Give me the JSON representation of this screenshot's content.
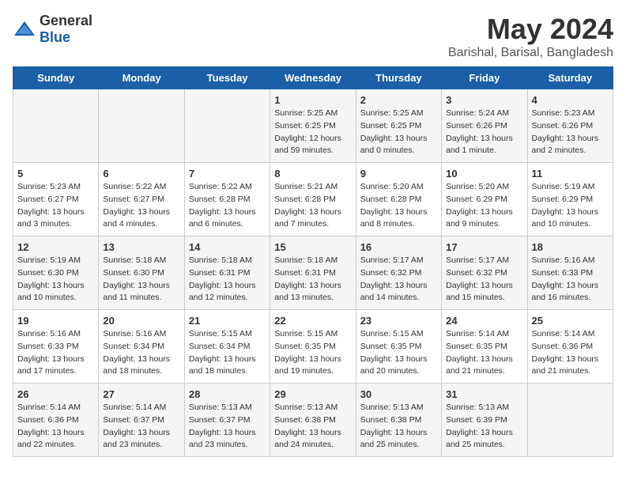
{
  "logo": {
    "general": "General",
    "blue": "Blue"
  },
  "title": "May 2024",
  "subtitle": "Barishal, Barisal, Bangladesh",
  "days_of_week": [
    "Sunday",
    "Monday",
    "Tuesday",
    "Wednesday",
    "Thursday",
    "Friday",
    "Saturday"
  ],
  "weeks": [
    [
      {
        "day": "",
        "info": ""
      },
      {
        "day": "",
        "info": ""
      },
      {
        "day": "",
        "info": ""
      },
      {
        "day": "1",
        "info": "Sunrise: 5:25 AM\nSunset: 6:25 PM\nDaylight: 12 hours\nand 59 minutes."
      },
      {
        "day": "2",
        "info": "Sunrise: 5:25 AM\nSunset: 6:25 PM\nDaylight: 13 hours\nand 0 minutes."
      },
      {
        "day": "3",
        "info": "Sunrise: 5:24 AM\nSunset: 6:26 PM\nDaylight: 13 hours\nand 1 minute."
      },
      {
        "day": "4",
        "info": "Sunrise: 5:23 AM\nSunset: 6:26 PM\nDaylight: 13 hours\nand 2 minutes."
      }
    ],
    [
      {
        "day": "5",
        "info": "Sunrise: 5:23 AM\nSunset: 6:27 PM\nDaylight: 13 hours\nand 3 minutes."
      },
      {
        "day": "6",
        "info": "Sunrise: 5:22 AM\nSunset: 6:27 PM\nDaylight: 13 hours\nand 4 minutes."
      },
      {
        "day": "7",
        "info": "Sunrise: 5:22 AM\nSunset: 6:28 PM\nDaylight: 13 hours\nand 6 minutes."
      },
      {
        "day": "8",
        "info": "Sunrise: 5:21 AM\nSunset: 6:28 PM\nDaylight: 13 hours\nand 7 minutes."
      },
      {
        "day": "9",
        "info": "Sunrise: 5:20 AM\nSunset: 6:28 PM\nDaylight: 13 hours\nand 8 minutes."
      },
      {
        "day": "10",
        "info": "Sunrise: 5:20 AM\nSunset: 6:29 PM\nDaylight: 13 hours\nand 9 minutes."
      },
      {
        "day": "11",
        "info": "Sunrise: 5:19 AM\nSunset: 6:29 PM\nDaylight: 13 hours\nand 10 minutes."
      }
    ],
    [
      {
        "day": "12",
        "info": "Sunrise: 5:19 AM\nSunset: 6:30 PM\nDaylight: 13 hours\nand 10 minutes."
      },
      {
        "day": "13",
        "info": "Sunrise: 5:18 AM\nSunset: 6:30 PM\nDaylight: 13 hours\nand 11 minutes."
      },
      {
        "day": "14",
        "info": "Sunrise: 5:18 AM\nSunset: 6:31 PM\nDaylight: 13 hours\nand 12 minutes."
      },
      {
        "day": "15",
        "info": "Sunrise: 5:18 AM\nSunset: 6:31 PM\nDaylight: 13 hours\nand 13 minutes."
      },
      {
        "day": "16",
        "info": "Sunrise: 5:17 AM\nSunset: 6:32 PM\nDaylight: 13 hours\nand 14 minutes."
      },
      {
        "day": "17",
        "info": "Sunrise: 5:17 AM\nSunset: 6:32 PM\nDaylight: 13 hours\nand 15 minutes."
      },
      {
        "day": "18",
        "info": "Sunrise: 5:16 AM\nSunset: 6:33 PM\nDaylight: 13 hours\nand 16 minutes."
      }
    ],
    [
      {
        "day": "19",
        "info": "Sunrise: 5:16 AM\nSunset: 6:33 PM\nDaylight: 13 hours\nand 17 minutes."
      },
      {
        "day": "20",
        "info": "Sunrise: 5:16 AM\nSunset: 6:34 PM\nDaylight: 13 hours\nand 18 minutes."
      },
      {
        "day": "21",
        "info": "Sunrise: 5:15 AM\nSunset: 6:34 PM\nDaylight: 13 hours\nand 18 minutes."
      },
      {
        "day": "22",
        "info": "Sunrise: 5:15 AM\nSunset: 6:35 PM\nDaylight: 13 hours\nand 19 minutes."
      },
      {
        "day": "23",
        "info": "Sunrise: 5:15 AM\nSunset: 6:35 PM\nDaylight: 13 hours\nand 20 minutes."
      },
      {
        "day": "24",
        "info": "Sunrise: 5:14 AM\nSunset: 6:35 PM\nDaylight: 13 hours\nand 21 minutes."
      },
      {
        "day": "25",
        "info": "Sunrise: 5:14 AM\nSunset: 6:36 PM\nDaylight: 13 hours\nand 21 minutes."
      }
    ],
    [
      {
        "day": "26",
        "info": "Sunrise: 5:14 AM\nSunset: 6:36 PM\nDaylight: 13 hours\nand 22 minutes."
      },
      {
        "day": "27",
        "info": "Sunrise: 5:14 AM\nSunset: 6:37 PM\nDaylight: 13 hours\nand 23 minutes."
      },
      {
        "day": "28",
        "info": "Sunrise: 5:13 AM\nSunset: 6:37 PM\nDaylight: 13 hours\nand 23 minutes."
      },
      {
        "day": "29",
        "info": "Sunrise: 5:13 AM\nSunset: 6:38 PM\nDaylight: 13 hours\nand 24 minutes."
      },
      {
        "day": "30",
        "info": "Sunrise: 5:13 AM\nSunset: 6:38 PM\nDaylight: 13 hours\nand 25 minutes."
      },
      {
        "day": "31",
        "info": "Sunrise: 5:13 AM\nSunset: 6:39 PM\nDaylight: 13 hours\nand 25 minutes."
      },
      {
        "day": "",
        "info": ""
      }
    ]
  ]
}
